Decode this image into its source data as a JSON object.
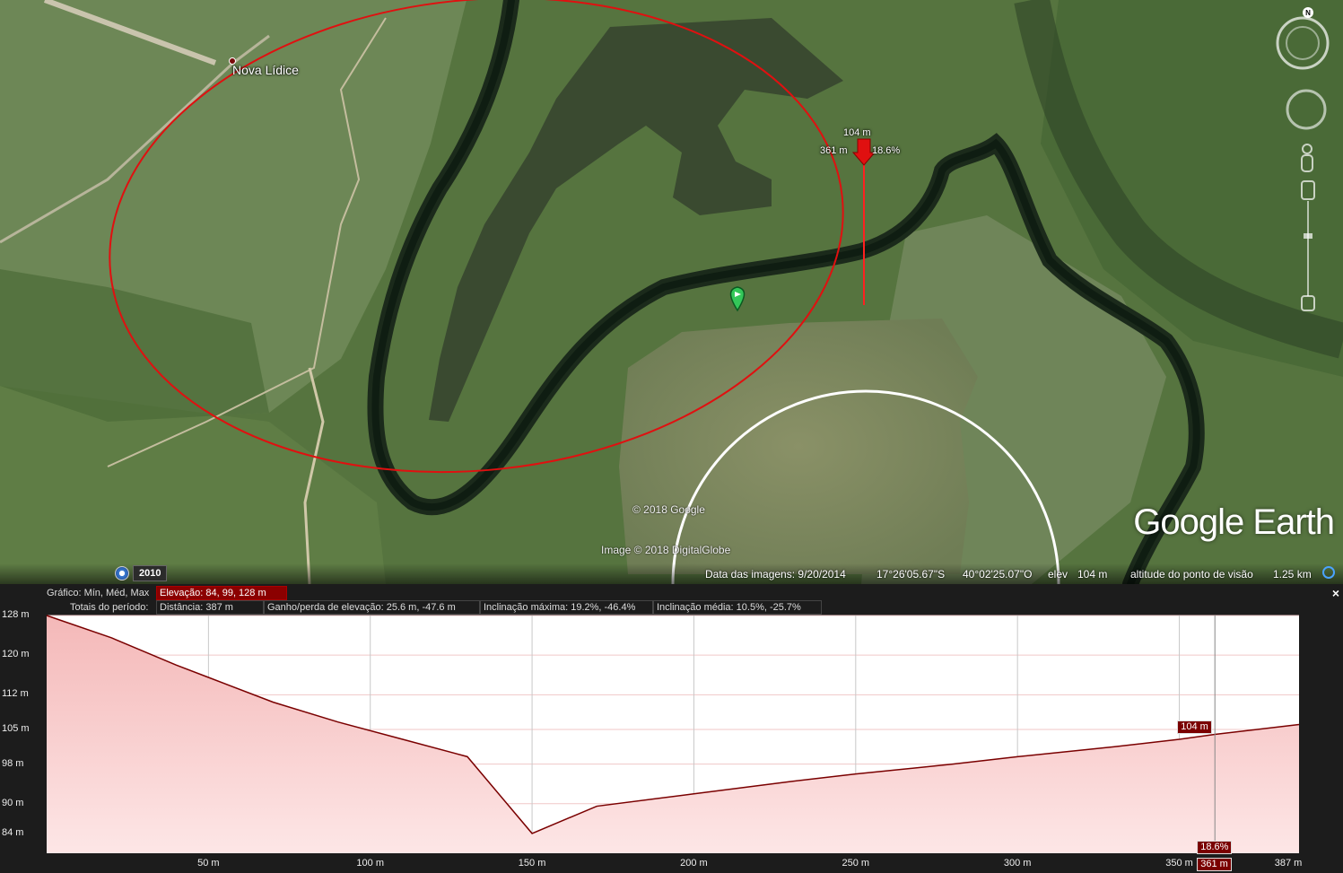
{
  "map": {
    "place_label": "Nova Lídice",
    "ruler": {
      "elevation": "104 m",
      "distance": "361 m",
      "slope": "18.6%"
    },
    "copyright_google": "© 2018 Google",
    "copyright_image": "Image © 2018 DigitalGlobe",
    "logo_google": "Google",
    "logo_earth": "Earth",
    "compass_north": "N",
    "history_year": "2010"
  },
  "statusbar": {
    "image_date": "Data das imagens: 9/20/2014",
    "lat": "17°26'05.67\"S",
    "lon": "40°02'25.07\"O",
    "elev_label": "elev",
    "elev_value": "104 m",
    "eye_label": "altitude do ponto de visão",
    "eye_value": "1.25 km"
  },
  "profile": {
    "row1": {
      "label": "Gráfico: Mín, Méd, Max",
      "value": "Elevação: 84, 99, 128 m"
    },
    "row2": {
      "label": "Totais do período:",
      "distance": "Distância: 387 m",
      "gain_loss": "Ganho/perda de elevação: 25.6 m, -47.6 m",
      "max_slope": "Inclinação máxima: 19.2%, -46.4%",
      "avg_slope": "Inclinação média: 10.5%, -25.7%"
    },
    "close": "×",
    "cursor": {
      "elevation_tag": "104 m",
      "slope_tag": "18.6%",
      "distance_tag": "361 m"
    }
  },
  "chart_data": {
    "type": "area",
    "title": "",
    "xlabel": "",
    "ylabel": "",
    "x_unit": "m",
    "y_unit": "m",
    "xlim": [
      0,
      387
    ],
    "ylim": [
      80,
      128
    ],
    "y_ticks": [
      "128 m",
      "120 m",
      "112 m",
      "105 m",
      "98 m",
      "90 m",
      "84 m"
    ],
    "y_tick_values": [
      128,
      120,
      112,
      105,
      98,
      90,
      84
    ],
    "x_ticks": [
      "50 m",
      "100 m",
      "150 m",
      "200 m",
      "250 m",
      "300 m",
      "350 m",
      "387 m"
    ],
    "x_tick_values": [
      50,
      100,
      150,
      200,
      250,
      300,
      350,
      387
    ],
    "cursor_x": 361,
    "series": [
      {
        "x": [
          0,
          20,
          40,
          50,
          70,
          90,
          110,
          130,
          150,
          170,
          200,
          230,
          250,
          280,
          300,
          330,
          350,
          361,
          387
        ],
        "values": [
          128,
          123.5,
          118,
          115.5,
          110.5,
          106.5,
          103,
          99.5,
          84,
          89.5,
          92,
          94.5,
          96,
          98,
          99.5,
          101.5,
          103,
          104,
          106
        ]
      }
    ],
    "colors": {
      "fill": "#f6c8c8",
      "line": "#7a0000"
    }
  }
}
